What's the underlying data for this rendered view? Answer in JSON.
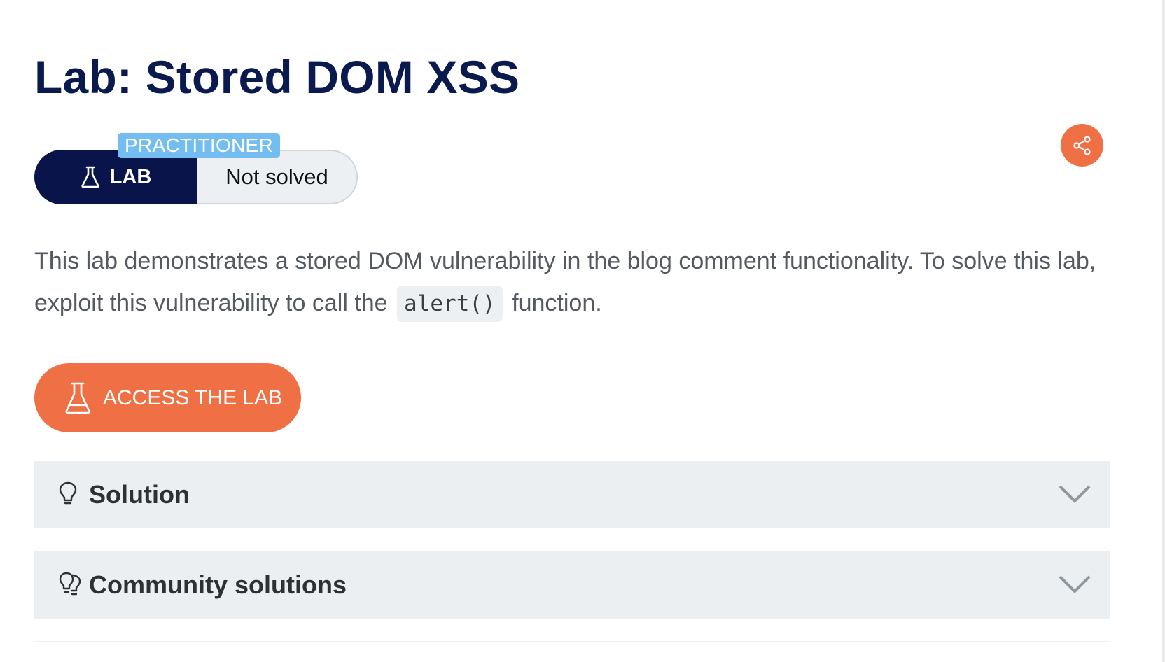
{
  "page": {
    "title": "Lab: Stored DOM XSS"
  },
  "status": {
    "level": "PRACTITIONER",
    "lab_label": "LAB",
    "solved_state": "Not solved"
  },
  "description": {
    "text_before": "This lab demonstrates a stored DOM vulnerability in the blog comment functionality. To solve this lab, exploit this vulnerability to call the",
    "code": "alert()",
    "text_after": "function."
  },
  "actions": {
    "access_lab": "ACCESS THE LAB"
  },
  "accordions": {
    "solution": "Solution",
    "community": "Community solutions"
  },
  "colors": {
    "title": "#0a1a4f",
    "lab_badge": "#08144a",
    "level_badge": "#73bdf0",
    "accent": "#ef7045",
    "accordion_bg": "#ebeff2"
  },
  "icons": {
    "lab": "flask-icon",
    "share": "share-icon",
    "solution": "lightbulb-icon",
    "community": "double-lightbulb-icon",
    "expand": "chevron-down-icon"
  }
}
